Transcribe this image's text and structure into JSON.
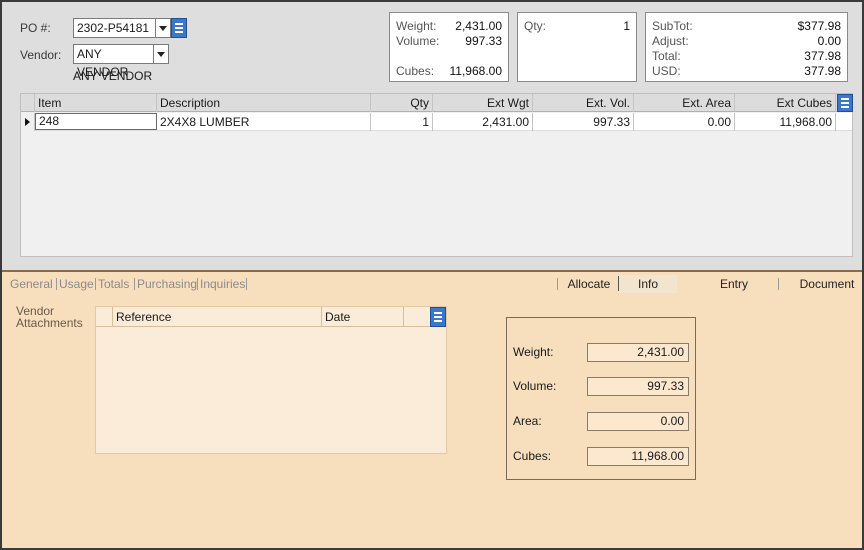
{
  "header": {
    "po_label": "PO #:",
    "po_value": "2302-P54181",
    "vendor_label": "Vendor:",
    "vendor_value": "ANY VENDOR",
    "vendor_name": "ANY VENDOR"
  },
  "weights": {
    "weight_label": "Weight:",
    "weight_value": "2,431.00",
    "volume_label": "Volume:",
    "volume_value": "997.33",
    "cubes_label": "Cubes:",
    "cubes_value": "11,968.00"
  },
  "qty_box": {
    "label": "Qty:",
    "value": "1"
  },
  "totals": {
    "subtot_label": "SubTot:",
    "subtot_value": "$377.98",
    "adjust_label": "Adjust:",
    "adjust_value": "0.00",
    "total_label": "Total:",
    "total_value": "377.98",
    "usd_label": "USD:",
    "usd_value": "377.98"
  },
  "grid": {
    "columns": [
      "Item",
      "Description",
      "Qty",
      "Ext Wgt",
      "Ext. Vol.",
      "Ext. Area",
      "Ext Cubes"
    ],
    "rows": [
      {
        "item": "248",
        "description": "2X4X8  LUMBER",
        "qty": "1",
        "ext_wgt": "2,431.00",
        "ext_vol": "997.33",
        "ext_area": "0.00",
        "ext_cubes": "11,968.00"
      }
    ]
  },
  "tabs_left": [
    "General",
    "Usage",
    "Totals",
    "Purchasing",
    "Inquiries"
  ],
  "tabs_right": [
    "Allocate",
    "Info",
    "Entry",
    "Document"
  ],
  "tabs_active": "Info",
  "attachments": {
    "label": "Vendor Attachments",
    "columns": [
      "Reference",
      "Date"
    ]
  },
  "info": {
    "weight_label": "Weight:",
    "weight_value": "2,431.00",
    "volume_label": "Volume:",
    "volume_value": "997.33",
    "area_label": "Area:",
    "area_value": "0.00",
    "cubes_label": "Cubes:",
    "cubes_value": "11,968.00"
  },
  "colors": {
    "top_panel": "#dedede",
    "bottom_panel": "#f7dfbe",
    "accent_button": "#3a78d0"
  }
}
